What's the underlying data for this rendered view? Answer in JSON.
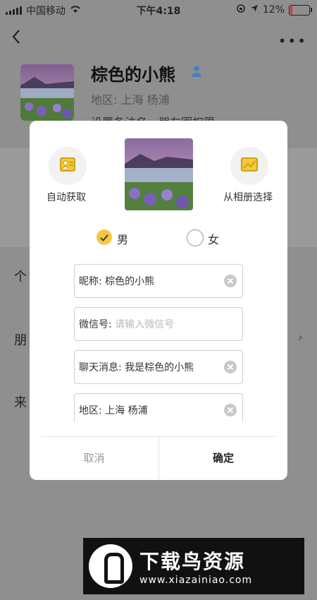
{
  "status_bar": {
    "carrier": "中国移动",
    "time": "下午4:18",
    "battery": "12%"
  },
  "profile": {
    "name": "棕色的小熊",
    "region": "地区: 上海 杨浦",
    "remark": "设置备注名，朋友圈权限"
  },
  "background_rows": [
    {
      "label": "个"
    },
    {
      "label": "朋"
    },
    {
      "label": "来"
    }
  ],
  "modal": {
    "auto_fetch_label": "自动获取",
    "album_label": "从相册选择",
    "gender_male": "男",
    "gender_female": "女",
    "selected_gender": "男",
    "fields": {
      "nickname": "昵称: 棕色的小熊",
      "wechat_id_label": "微信号:",
      "wechat_id_placeholder": "请输入微信号",
      "chat_message": "聊天消息: 我是棕色的小熊",
      "region": "地区: 上海 杨浦"
    },
    "cancel_label": "取消",
    "ok_label": "确定"
  },
  "watermark": {
    "title": "下载鸟资源",
    "url": "www.xiazainiao.com"
  },
  "colors": {
    "accent_yellow": "#f5c842",
    "overlay_gray": "#8f8f8f",
    "icon_blue": "#4a7fb8"
  }
}
